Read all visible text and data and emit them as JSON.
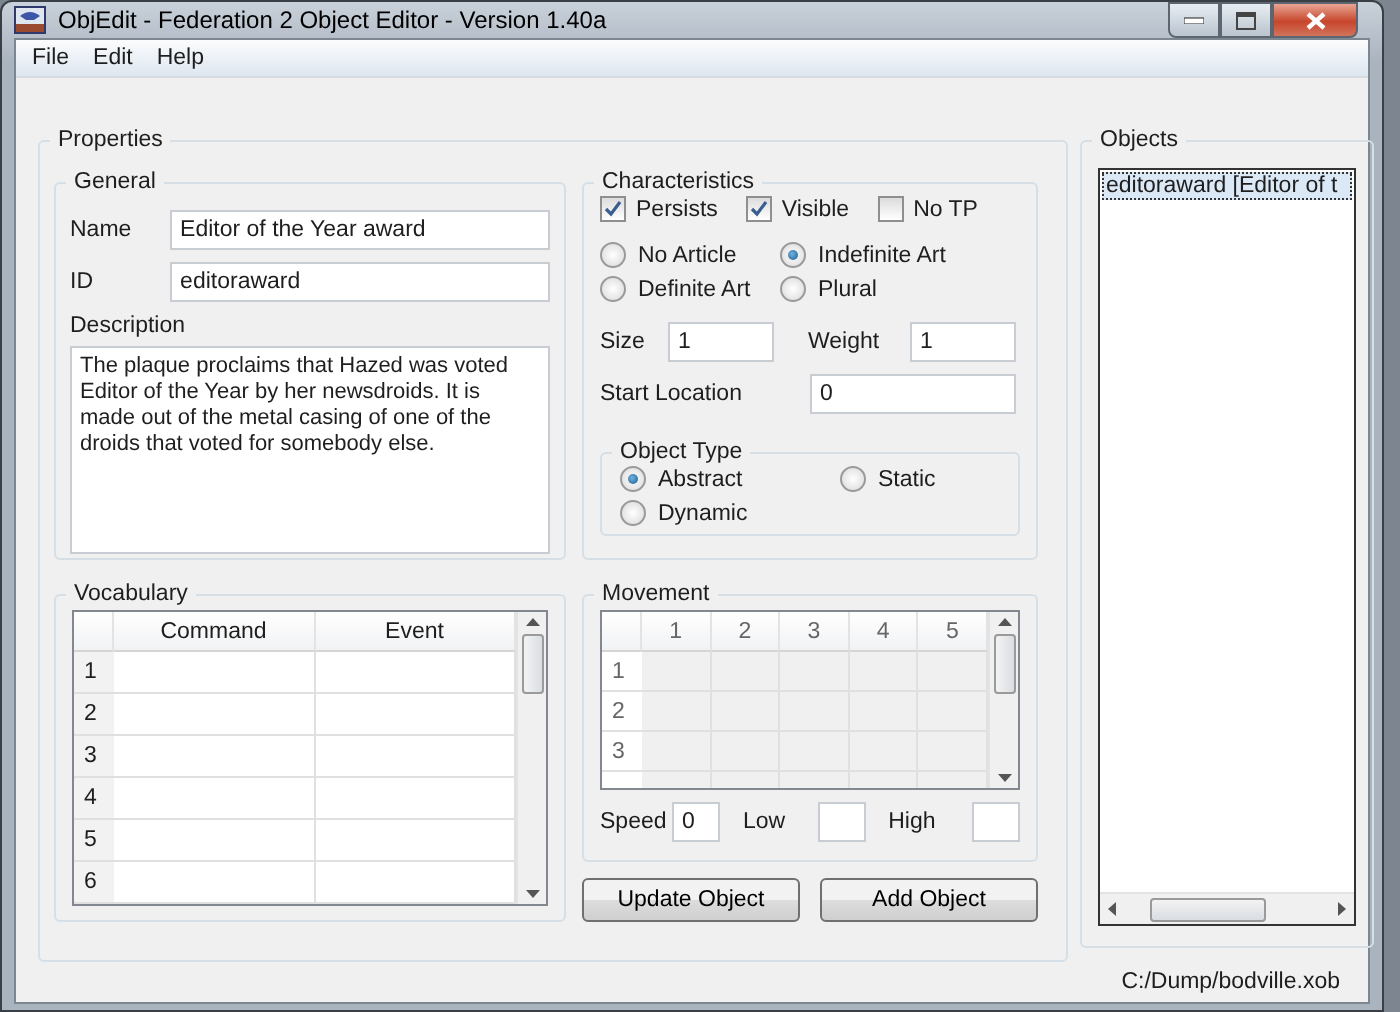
{
  "window": {
    "title": "ObjEdit - Federation 2 Object Editor - Version 1.40a"
  },
  "menu": [
    {
      "label": "File"
    },
    {
      "label": "Edit"
    },
    {
      "label": "Help"
    }
  ],
  "properties": {
    "title": "Properties",
    "general": {
      "title": "General",
      "fields": [
        {
          "label": "Name",
          "value": "Editor of the Year award"
        },
        {
          "label": "ID",
          "value": "editoraward"
        }
      ],
      "description_label": "Description",
      "description": "The plaque proclaims that Hazed was voted Editor of the Year by her newsdroids. It is made out of the metal casing of one of the droids that voted for somebody else."
    },
    "characteristics": {
      "title": "Characteristics",
      "checkboxes": [
        {
          "label": "Persists",
          "checked": true
        },
        {
          "label": "Visible",
          "checked": true
        },
        {
          "label": "No TP",
          "checked": false
        }
      ],
      "articles": [
        {
          "label": "No Article",
          "selected": false
        },
        {
          "label": "Indefinite Art",
          "selected": true
        },
        {
          "label": "Definite Art",
          "selected": false
        },
        {
          "label": "Plural",
          "selected": false
        }
      ],
      "size": {
        "label": "Size",
        "value": "1"
      },
      "weight": {
        "label": "Weight",
        "value": "1"
      },
      "start_location": {
        "label": "Start Location",
        "value": "0"
      },
      "object_type": {
        "title": "Object Type",
        "options": [
          {
            "label": "Abstract",
            "selected": true
          },
          {
            "label": "Static",
            "selected": false
          },
          {
            "label": "Dynamic",
            "selected": false
          }
        ]
      }
    },
    "vocabulary": {
      "title": "Vocabulary",
      "columns": [
        "Command",
        "Event"
      ],
      "rows": [
        "1",
        "2",
        "3",
        "4",
        "5",
        "6"
      ]
    },
    "movement": {
      "title": "Movement",
      "columns": [
        "1",
        "2",
        "3",
        "4",
        "5"
      ],
      "rows": [
        "1",
        "2",
        "3"
      ],
      "fields": [
        {
          "label": "Speed",
          "value": "0"
        },
        {
          "label": "Low"
        },
        {
          "label": "High"
        }
      ]
    },
    "buttons": [
      {
        "label": "Update Object"
      },
      {
        "label": "Add Object"
      }
    ]
  },
  "objects": {
    "title": "Objects",
    "items": [
      {
        "label": "editoraward [Editor of t",
        "selected": true
      }
    ]
  },
  "status_bar": {
    "path": "C:/Dump/bodville.xob"
  }
}
